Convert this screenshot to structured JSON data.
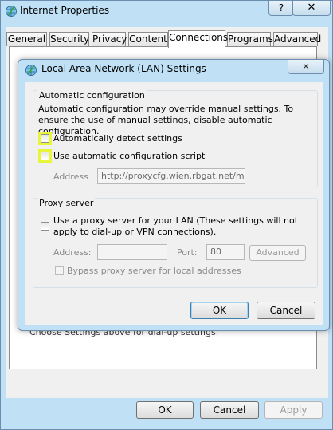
{
  "window": {
    "title": "Internet Properties",
    "help_label": "?",
    "close_label": "✕"
  },
  "tabs": [
    {
      "label": "General"
    },
    {
      "label": "Security"
    },
    {
      "label": "Privacy"
    },
    {
      "label": "Content"
    },
    {
      "label": "Connections",
      "active": true
    },
    {
      "label": "Programs"
    },
    {
      "label": "Advanced"
    }
  ],
  "panel": {
    "hint_text": "Choose Settings above for dial-up settings."
  },
  "footer": {
    "ok_label": "OK",
    "cancel_label": "Cancel",
    "apply_label": "Apply"
  },
  "lan_dialog": {
    "title": "Local Area Network (LAN) Settings",
    "close_label": "✕",
    "auto_config": {
      "group_label": "Automatic configuration",
      "description": "Automatic configuration may override manual settings.  To ensure the use of manual settings, disable automatic configuration.",
      "auto_detect_label": "Automatically detect settings",
      "auto_detect_checked": false,
      "script_label": "Use automatic configuration script",
      "script_checked": false,
      "address_label": "Address",
      "address_value": "http://proxycfg.wien.rbgat.net/mwg"
    },
    "proxy": {
      "group_label": "Proxy server",
      "use_proxy_label": "Use a proxy server for your LAN (These settings will not apply to dial-up or VPN connections).",
      "use_proxy_checked": false,
      "address_label": "Address:",
      "address_value": "",
      "port_label": "Port:",
      "port_value": "80",
      "advanced_label": "Advanced",
      "bypass_label": "Bypass proxy server for local addresses",
      "bypass_checked": false
    },
    "ok_label": "OK",
    "cancel_label": "Cancel"
  },
  "colors": {
    "frame": "#bfe0f5",
    "highlight": "#e9f53b"
  }
}
